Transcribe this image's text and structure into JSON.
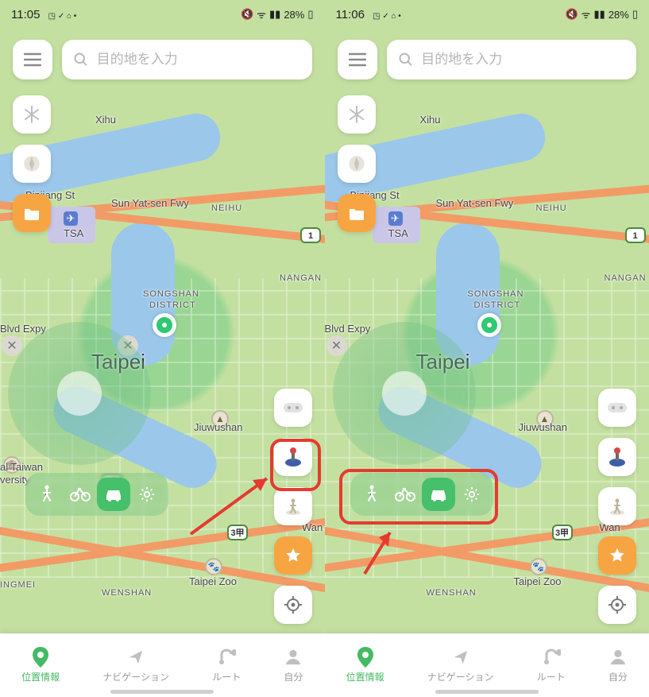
{
  "screens": [
    "left",
    "right"
  ],
  "statusbar": {
    "time_left": "11:05",
    "time_right": "11:06",
    "icons": "◳ ✓ ⌂ •",
    "right": "▩ ⋮ ᯤ ⏷‎ 28%▯",
    "battery": "28%"
  },
  "search": {
    "placeholder": "目的地を入力"
  },
  "left_tools": [
    {
      "name": "snow",
      "icon": "snowflake"
    },
    {
      "name": "compass",
      "icon": "compass"
    },
    {
      "name": "folder",
      "icon": "folder",
      "style": "orange"
    }
  ],
  "right_tools": [
    {
      "name": "joystick",
      "icon": "gamepad"
    },
    {
      "name": "joystick-alt",
      "icon": "joystick"
    },
    {
      "name": "walk3d",
      "icon": "figure-walk"
    },
    {
      "name": "favorites",
      "icon": "star",
      "style": "star"
    },
    {
      "name": "locate",
      "icon": "crosshair"
    }
  ],
  "modes": [
    {
      "name": "walk",
      "active": false
    },
    {
      "name": "bike",
      "active": false
    },
    {
      "name": "car",
      "active": true
    },
    {
      "name": "settings",
      "active": false
    }
  ],
  "tabs": [
    {
      "name": "location",
      "label": "位置情報",
      "active": true
    },
    {
      "name": "navigation",
      "label": "ナビゲーション",
      "active": false
    },
    {
      "name": "route",
      "label": "ルート",
      "active": false
    },
    {
      "name": "self",
      "label": "自分",
      "active": false
    }
  ],
  "map": {
    "labels": {
      "xihu": "Xihu",
      "binjiang": "Binjiang St",
      "sunYat": "Sun Yat-sen Fwy",
      "neihu": "NEIHU",
      "tsa": "TSA",
      "nangang": "NANGAN",
      "songshan1": "SONGSHAN",
      "songshan2": "DISTRICT",
      "blvdExpy": "Blvd Expy",
      "taipei": "Taipei",
      "jiuwushan": "Jiuwushan",
      "alTaiwan1": "al Taiwan",
      "alTaiwan2": "versity",
      "wan": "Wan",
      "taipeiZoo": "Taipei Zoo",
      "ingmei": "INGMEI",
      "wenshan": "WENSHAN",
      "shield1": "1",
      "shield3a": "3甲",
      "shield3b": "3甲"
    }
  },
  "annotations": {
    "left": {
      "target": "joystick-alt button"
    },
    "right": {
      "target": "mode bar"
    }
  }
}
